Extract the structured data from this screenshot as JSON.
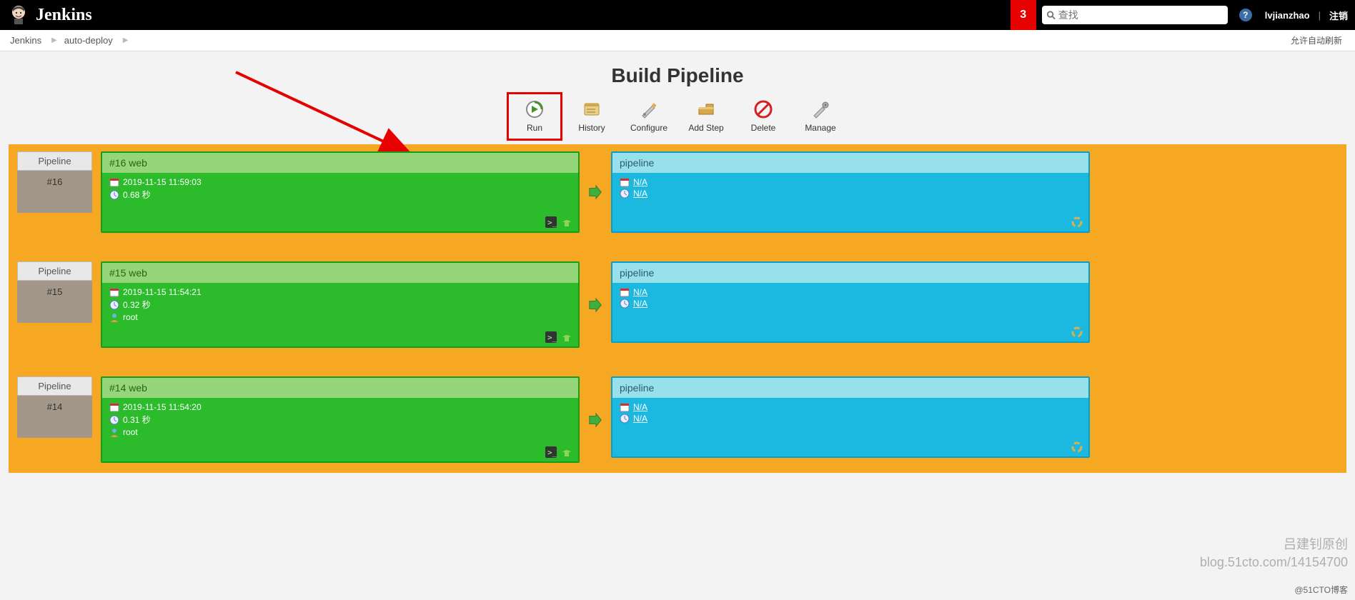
{
  "header": {
    "brand": "Jenkins",
    "notif_count": "3",
    "search_placeholder": "查找",
    "username": "lvjianzhao",
    "logout": "注销"
  },
  "breadcrumb": {
    "items": [
      "Jenkins",
      "auto-deploy"
    ],
    "auto_refresh": "允许自动刷新"
  },
  "page": {
    "title": "Build Pipeline"
  },
  "toolbar": [
    {
      "id": "run",
      "label": "Run"
    },
    {
      "id": "history",
      "label": "History"
    },
    {
      "id": "configure",
      "label": "Configure"
    },
    {
      "id": "add-step",
      "label": "Add Step"
    },
    {
      "id": "delete",
      "label": "Delete"
    },
    {
      "id": "manage",
      "label": "Manage"
    }
  ],
  "rows": [
    {
      "side_label": "Pipeline",
      "side_num": "#16",
      "left": {
        "title": "#16 web",
        "timestamp": "2019-11-15 11:59:03",
        "duration": "0.68 秒",
        "user": null
      },
      "right": {
        "title": "pipeline",
        "na1": "N/A",
        "na2": "N/A"
      }
    },
    {
      "side_label": "Pipeline",
      "side_num": "#15",
      "left": {
        "title": "#15 web",
        "timestamp": "2019-11-15 11:54:21",
        "duration": "0.32 秒",
        "user": "root"
      },
      "right": {
        "title": "pipeline",
        "na1": "N/A",
        "na2": "N/A"
      }
    },
    {
      "side_label": "Pipeline",
      "side_num": "#14",
      "left": {
        "title": "#14 web",
        "timestamp": "2019-11-15 11:54:20",
        "duration": "0.31 秒",
        "user": "root"
      },
      "right": {
        "title": "pipeline",
        "na1": "N/A",
        "na2": "N/A"
      }
    }
  ],
  "watermark": {
    "line1": "吕建钊原创",
    "line2": "blog.51cto.com/14154700"
  },
  "footer_credit": "@51CTO博客"
}
